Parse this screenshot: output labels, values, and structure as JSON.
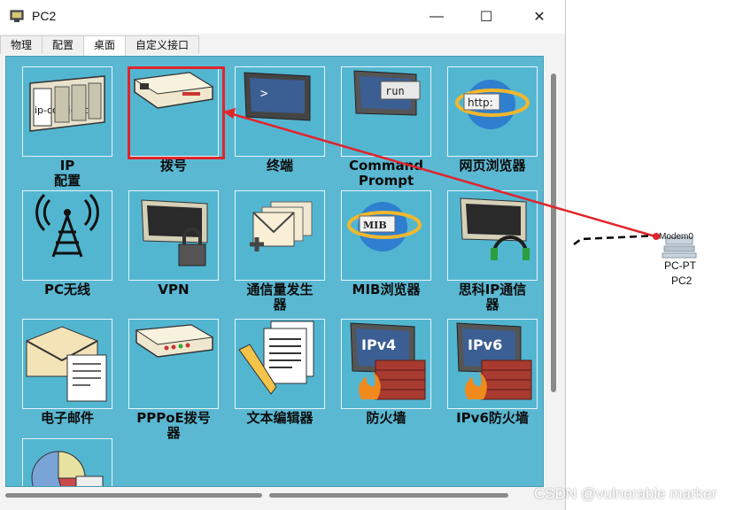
{
  "window": {
    "title": "PC2"
  },
  "window_controls": {
    "minimize": "—",
    "maximize": "☐",
    "close": "✕"
  },
  "tabs": [
    {
      "label": "物理"
    },
    {
      "label": "配置"
    },
    {
      "label": "桌面",
      "active": true
    },
    {
      "label": "自定义接口"
    }
  ],
  "apps": [
    {
      "label": "IP\n配置",
      "icon": "ip-config-icon"
    },
    {
      "label": "拨号",
      "icon": "dialup-modem-icon"
    },
    {
      "label": "终端",
      "icon": "terminal-icon"
    },
    {
      "label": "Command\nPrompt",
      "icon": "command-prompt-icon",
      "icon_text": "run"
    },
    {
      "label": "网页浏览器",
      "icon": "web-browser-icon",
      "icon_text": "http:"
    },
    {
      "label": "PC无线",
      "icon": "wireless-tower-icon"
    },
    {
      "label": "VPN",
      "icon": "vpn-lock-icon"
    },
    {
      "label": "通信量发生\n器",
      "icon": "traffic-generator-icon"
    },
    {
      "label": "MIB浏览器",
      "icon": "mib-browser-icon",
      "icon_text": "MIB"
    },
    {
      "label": "思科IP通信\n器",
      "icon": "ip-communicator-icon"
    },
    {
      "label": "电子邮件",
      "icon": "email-icon"
    },
    {
      "label": "PPPoE拨号\n器",
      "icon": "pppoe-dialer-icon"
    },
    {
      "label": "文本编辑器",
      "icon": "text-editor-icon"
    },
    {
      "label": "防火墙",
      "icon": "firewall-icon",
      "icon_text": "IPv4"
    },
    {
      "label": "IPv6防火墙",
      "icon": "ipv6-firewall-icon",
      "icon_text": "IPv6"
    },
    {
      "label": "",
      "icon": "pie-chart-icon"
    }
  ],
  "topology": {
    "modem_label": "Modem0",
    "device_type": "PC-PT",
    "device_name": "PC2"
  },
  "watermark": "CSDN @vulnerable marker",
  "colors": {
    "desktop_bg": "#5ab8d2",
    "highlight": "#e0242b",
    "arrow": "#e0242b"
  }
}
